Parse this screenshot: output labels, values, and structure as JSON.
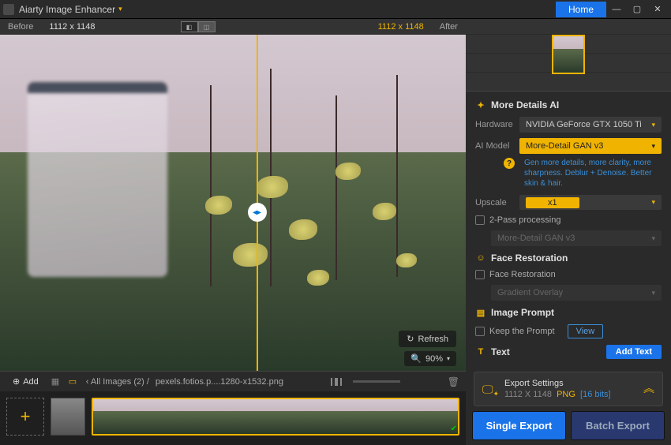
{
  "app": {
    "title": "Aiarty Image Enhancer",
    "home": "Home"
  },
  "winctl": {
    "min": "—",
    "max": "▢",
    "close": "✕"
  },
  "compbar": {
    "before": "Before",
    "after": "After",
    "dim_left": "1112 x 1148",
    "dim_right": "1112 x 1148"
  },
  "viewer": {
    "refresh": "Refresh",
    "zoom": "90%",
    "filmbar": {
      "add": "Add",
      "nav_prefix": "‹   All Images (",
      "count": "2",
      "nav_suffix": ")   /",
      "filename": "pexels.fotios.p....1280-x1532.png"
    }
  },
  "panel": {
    "sec_details": "More Details AI",
    "hardware_l": "Hardware",
    "hardware_v": "NVIDIA GeForce GTX 1050 Ti",
    "aimodel_l": "AI Model",
    "aimodel_v": "More-Detail GAN  v3",
    "aimodel_help": "Gen more details, more clarity, more sharpness. Deblur + Denoise. Better skin & hair.",
    "upscale_l": "Upscale",
    "upscale_v": "x1",
    "twopass": "2-Pass processing",
    "twopass_sel": "More-Detail GAN  v3",
    "sec_face": "Face Restoration",
    "face_chk": "Face Restoration",
    "face_sel": "Gradient Overlay",
    "sec_prompt": "Image Prompt",
    "keep_prompt": "Keep the Prompt",
    "view": "View",
    "sec_text": "Text",
    "add_text": "Add Text",
    "export": {
      "title": "Export Settings",
      "dim": "1112 X 1148",
      "fmt": "PNG",
      "bits": "[16 bits]"
    },
    "single": "Single Export",
    "batch": "Batch Export"
  }
}
